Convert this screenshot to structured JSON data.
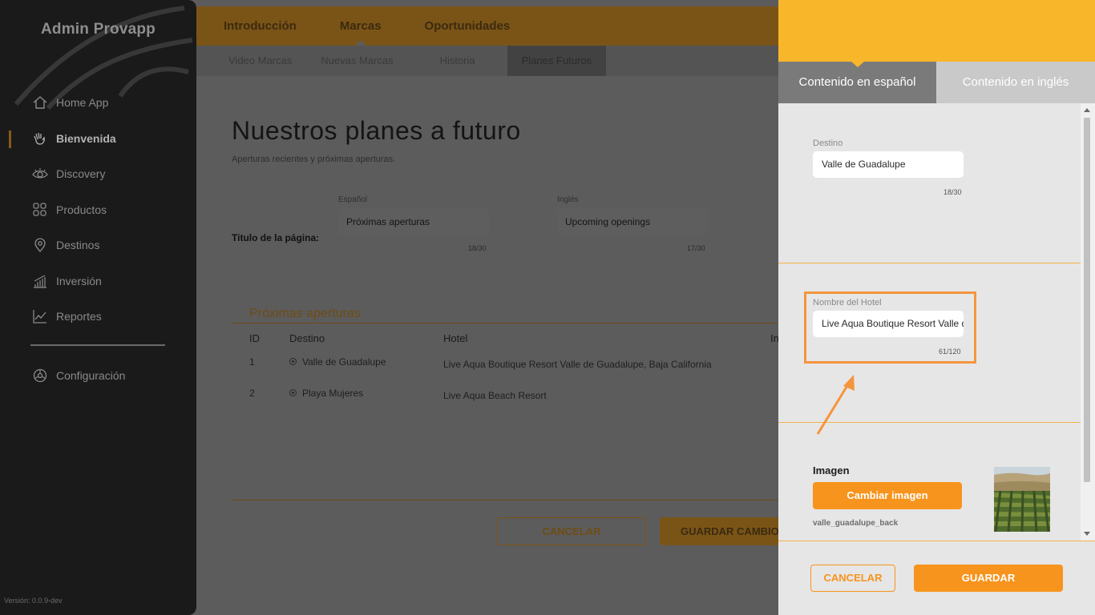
{
  "sidebar": {
    "brand": "Admin Provapp",
    "items": [
      {
        "label": "Home App",
        "icon": "home-icon",
        "active": false
      },
      {
        "label": "Bienvenida",
        "icon": "waving-hand-icon",
        "active": true
      },
      {
        "label": "Discovery",
        "icon": "eye-icon",
        "active": false
      },
      {
        "label": "Productos",
        "icon": "grid-icon",
        "active": false
      },
      {
        "label": "Destinos",
        "icon": "map-pin-icon",
        "active": false
      },
      {
        "label": "Inversión",
        "icon": "bar-chart-icon",
        "active": false
      },
      {
        "label": "Reportes",
        "icon": "line-chart-icon",
        "active": false
      }
    ],
    "config_label": "Configuración",
    "version": "Versión: 0.0.9-dev"
  },
  "topnav": {
    "tabs": [
      "Introducción",
      "Marcas",
      "Oportunidades"
    ],
    "active": "Marcas"
  },
  "subnav": {
    "tabs": [
      "Video Marcas",
      "Nuevas Marcas",
      "Historia",
      "Planes Futuros"
    ],
    "active": "Planes Futuros"
  },
  "page": {
    "title": "Nuestros planes a futuro",
    "subtitle": "Aperturas recientes y próximas aperturas.",
    "title_field_label": "Titulo de la página:",
    "es_label": "Español",
    "es_value": "Próximas aperturas",
    "es_counter": "18/30",
    "en_label": "Inglés",
    "en_value": "Upcoming openings",
    "en_counter": "17/30"
  },
  "openings": {
    "section_title": "Próximas aperturas",
    "columns": [
      "ID",
      "Destino",
      "Hotel",
      "In"
    ],
    "rows": [
      {
        "id": "1",
        "destino": "Valle de Guadalupe",
        "hotel": "Live Aqua Boutique Resort Valle de Guadalupe, Baja California"
      },
      {
        "id": "2",
        "destino": "Playa Mujeres",
        "hotel": "Live Aqua Beach Resort"
      }
    ],
    "cancel_label": "CANCELAR",
    "save_label": "GUARDAR CAMBIOS"
  },
  "panel": {
    "tab_es": "Contenido en español",
    "tab_en": "Contenido en inglés",
    "destino_label": "Destino",
    "destino_value": "Valle de Guadalupe",
    "destino_counter": "18/30",
    "hotel_label": "Nombre del Hotel",
    "hotel_value": "Live Aqua Boutique Resort Valle de Guadalupe, Baja California",
    "hotel_counter": "61/120",
    "image_label": "Imagen",
    "change_image_label": "Cambiar imagen",
    "filename": "valle_guadalupe_back",
    "cancel_label": "CANCELAR",
    "save_label": "GUARDAR"
  },
  "colors": {
    "accent": "#f7941d",
    "header_yellow": "#f8b62b",
    "annotation": "#f4953d"
  }
}
